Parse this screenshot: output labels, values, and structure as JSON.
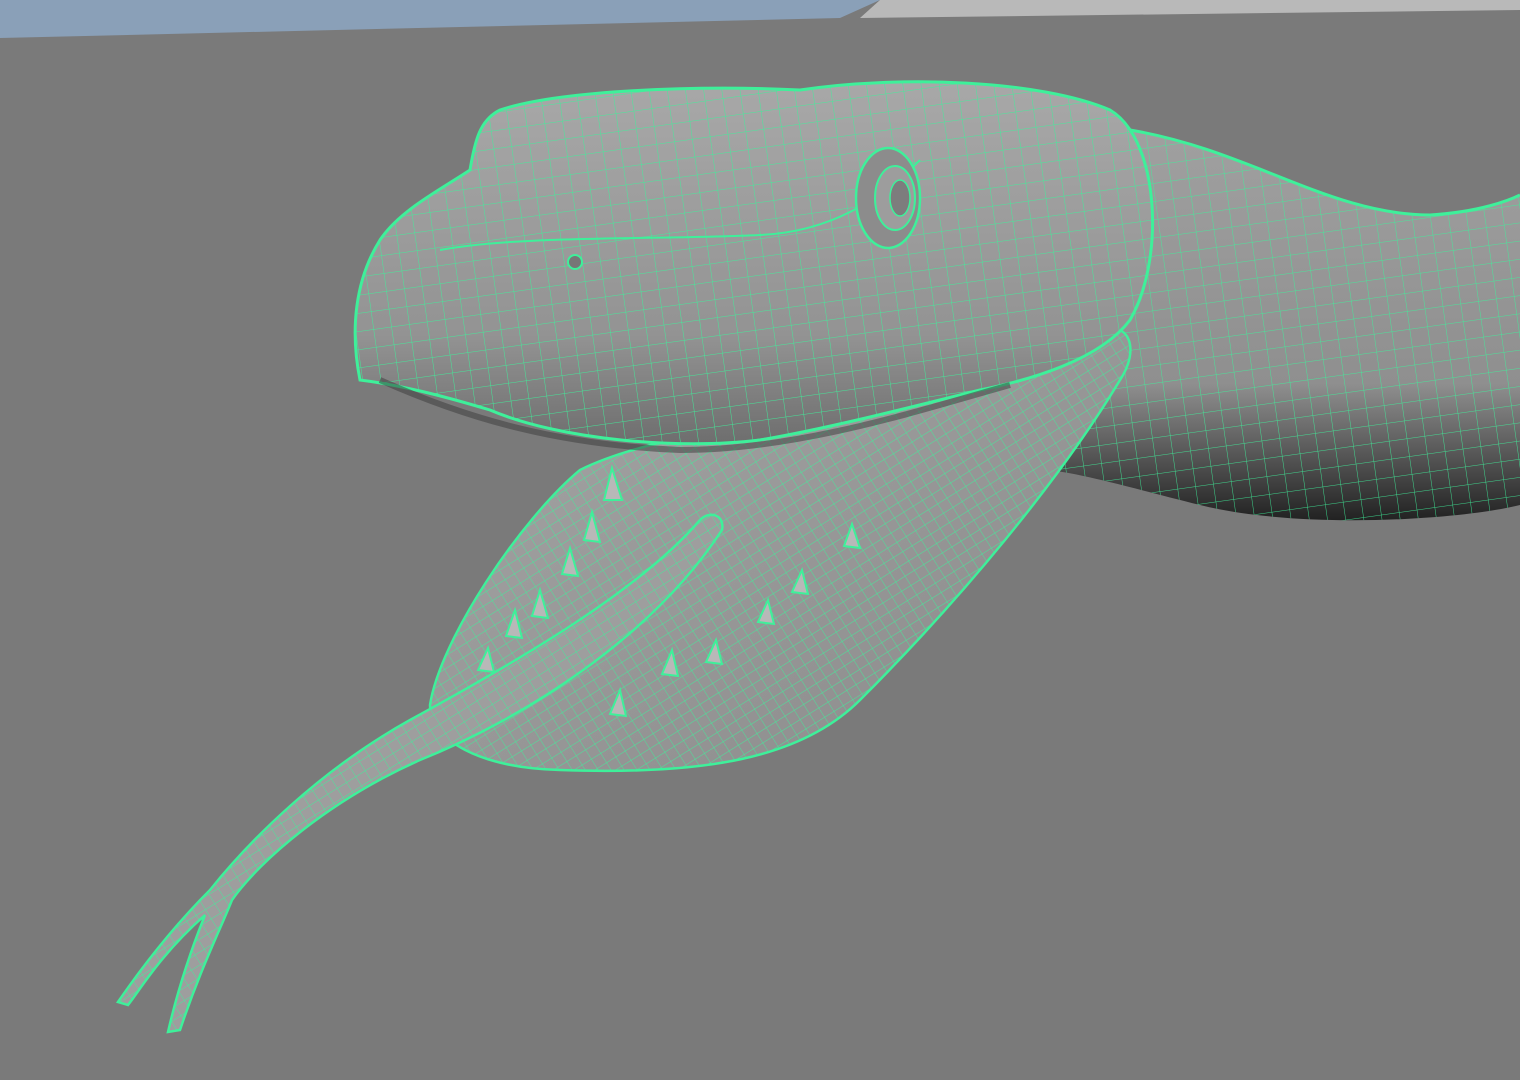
{
  "viewport": {
    "background_color": "#7a7a7a",
    "horizon_sky_color": "#8aa0b8",
    "horizon_light_color": "#c2c2c2"
  },
  "model": {
    "shaded_color": "#9a9a9a",
    "shadow_color": "#3a3a3a",
    "wireframe_color": "#3ef09a",
    "components": [
      "snake-head",
      "snake-neck",
      "lower-jaw",
      "tongue",
      "eye",
      "nostril",
      "teeth"
    ]
  }
}
